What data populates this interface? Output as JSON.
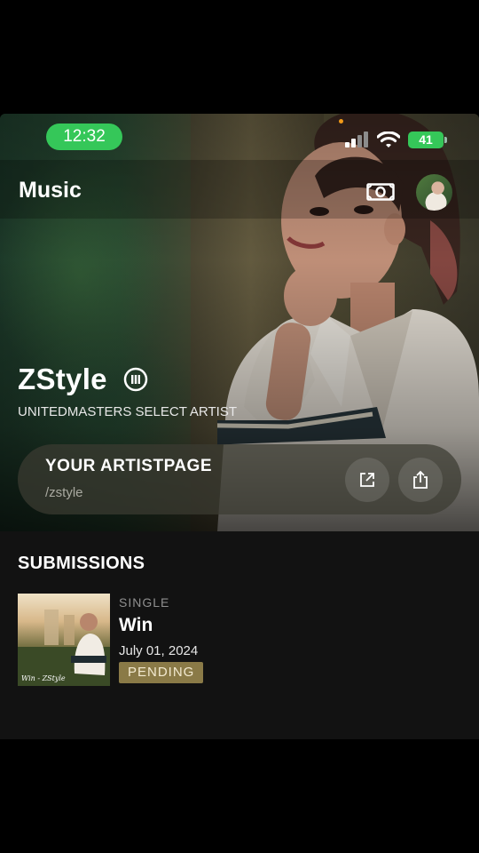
{
  "status": {
    "time": "12:32",
    "battery": "41"
  },
  "header": {
    "title": "Music"
  },
  "artist": {
    "name": "ZStyle",
    "subtitle": "UNITEDMASTERS SELECT ARTIST"
  },
  "artistpage": {
    "title": "YOUR ARTISTPAGE",
    "handle": "/zstyle"
  },
  "submissions": {
    "heading": "SUBMISSIONS",
    "items": [
      {
        "type": "SINGLE",
        "title": "Win",
        "date": "July 01, 2024",
        "status": "PENDING",
        "cover_text": "Win - ZStyle"
      }
    ]
  },
  "colors": {
    "accent_green": "#35c759",
    "pending_badge": "#8a7a47",
    "background": "#121212"
  },
  "icons": [
    "signal-icon",
    "wifi-icon",
    "battery-icon",
    "money-icon",
    "verified-icon",
    "external-link-icon",
    "share-icon"
  ]
}
